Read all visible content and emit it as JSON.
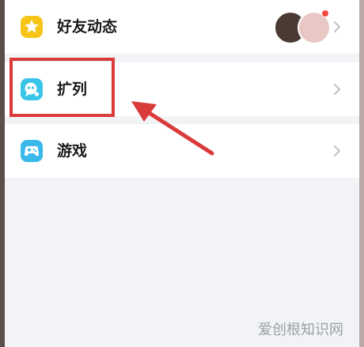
{
  "menu": {
    "items": [
      {
        "label": "好友动态",
        "icon": "star-icon"
      },
      {
        "label": "扩列",
        "icon": "chat-bubble-icon"
      },
      {
        "label": "游戏",
        "icon": "gamepad-icon"
      }
    ]
  },
  "watermark": "爱创根知识网",
  "colors": {
    "highlight": "#d93b3b",
    "moments_icon": "#f5c518",
    "kuolie_icon": "#39c5e8",
    "games_icon": "#39b8ea",
    "badge": "#f04a3e"
  }
}
